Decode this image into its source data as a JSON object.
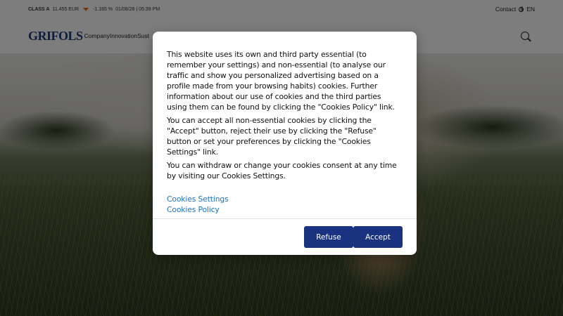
{
  "topbar": {
    "ticker_label": "CLASS A",
    "ticker_value": "11.455 EUR",
    "ticker_change": "-1.165 %",
    "ticker_datetime": "01/08/26 | 05:39 PM",
    "change_direction_icon": "arrow-down-icon",
    "change_color": "#e06a1b",
    "contact_label": "Contact",
    "language_label": "EN"
  },
  "navbar": {
    "logo_text": "GRIFOLS",
    "items": [
      {
        "label": "Company"
      },
      {
        "label": "Innovation"
      },
      {
        "label": "Sust"
      }
    ],
    "search_icon": "search-icon"
  },
  "cookie_modal": {
    "paragraphs": [
      "This website uses its own and third party essential (to remember your settings) and non-essential (to analyse our traffic and show you personalized advertising based on a profile made from your browsing habits) cookies. Further information about our use of cookies and the third parties using them can be found by clicking the \"Cookies Policy\" link.",
      "You can accept all non-essential cookies by clicking the \"Accept\" button, reject their use by clicking the \"Refuse\" button or set your preferences by clicking the \"Cookies Settings\" link.",
      "You can withdraw or change your cookies consent at any time by visiting our Cookies Settings."
    ],
    "settings_link": "Cookies Settings",
    "policy_link": "Cookies Policy",
    "refuse_label": "Refuse",
    "accept_label": "Accept",
    "button_color": "#1a3380",
    "link_color": "#1a73c8"
  }
}
